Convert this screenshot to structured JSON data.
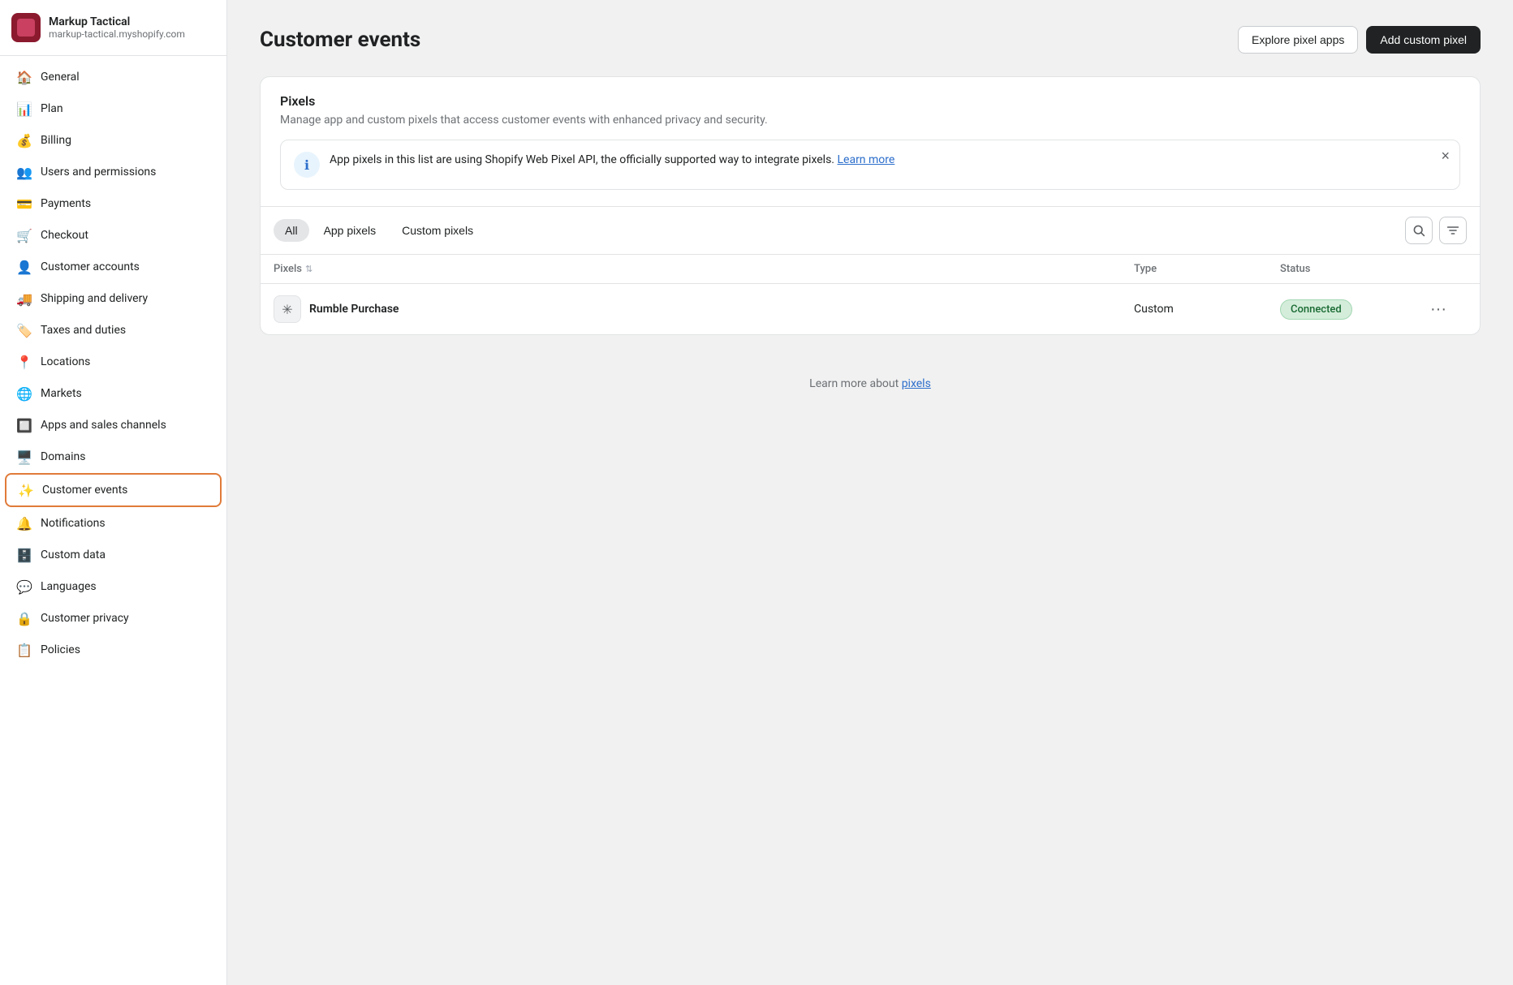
{
  "store": {
    "name": "Markup Tactical",
    "url": "markup-tactical.myshopify.com"
  },
  "sidebar": {
    "items": [
      {
        "id": "general",
        "label": "General",
        "icon": "🏠"
      },
      {
        "id": "plan",
        "label": "Plan",
        "icon": "📊"
      },
      {
        "id": "billing",
        "label": "Billing",
        "icon": "💰"
      },
      {
        "id": "users",
        "label": "Users and permissions",
        "icon": "👥"
      },
      {
        "id": "payments",
        "label": "Payments",
        "icon": "💳"
      },
      {
        "id": "checkout",
        "label": "Checkout",
        "icon": "🛒"
      },
      {
        "id": "customer-accounts",
        "label": "Customer accounts",
        "icon": "👤"
      },
      {
        "id": "shipping",
        "label": "Shipping and delivery",
        "icon": "🚚"
      },
      {
        "id": "taxes",
        "label": "Taxes and duties",
        "icon": "🏷️"
      },
      {
        "id": "locations",
        "label": "Locations",
        "icon": "📍"
      },
      {
        "id": "markets",
        "label": "Markets",
        "icon": "🌐"
      },
      {
        "id": "apps",
        "label": "Apps and sales channels",
        "icon": "🔲"
      },
      {
        "id": "domains",
        "label": "Domains",
        "icon": "🖥️"
      },
      {
        "id": "customer-events",
        "label": "Customer events",
        "icon": "✨",
        "active": true
      },
      {
        "id": "notifications",
        "label": "Notifications",
        "icon": "🔔"
      },
      {
        "id": "custom-data",
        "label": "Custom data",
        "icon": "🗄️"
      },
      {
        "id": "languages",
        "label": "Languages",
        "icon": "💬"
      },
      {
        "id": "customer-privacy",
        "label": "Customer privacy",
        "icon": "🔒"
      },
      {
        "id": "policies",
        "label": "Policies",
        "icon": "📋"
      }
    ]
  },
  "page": {
    "title": "Customer events",
    "explore_btn": "Explore pixel apps",
    "add_btn": "Add custom pixel"
  },
  "pixels_section": {
    "title": "Pixels",
    "description": "Manage app and custom pixels that access customer events with enhanced privacy and security.",
    "banner": {
      "text": "App pixels in this list are using Shopify Web Pixel API, the officially supported way to integrate pixels.",
      "link_text": "Learn more",
      "link_url": "#"
    }
  },
  "filter_tabs": [
    {
      "id": "all",
      "label": "All",
      "active": true
    },
    {
      "id": "app-pixels",
      "label": "App pixels",
      "active": false
    },
    {
      "id": "custom-pixels",
      "label": "Custom pixels",
      "active": false
    }
  ],
  "table": {
    "columns": [
      {
        "id": "pixels",
        "label": "Pixels",
        "sortable": true
      },
      {
        "id": "type",
        "label": "Type",
        "sortable": false
      },
      {
        "id": "status",
        "label": "Status",
        "sortable": false
      },
      {
        "id": "actions",
        "label": "",
        "sortable": false
      }
    ],
    "rows": [
      {
        "id": "rumble-purchase",
        "name": "Rumble Purchase",
        "type": "Custom",
        "status": "Connected",
        "status_type": "connected"
      }
    ]
  },
  "learn_more": {
    "text": "Learn more about",
    "link_text": "pixels",
    "link_url": "#"
  }
}
